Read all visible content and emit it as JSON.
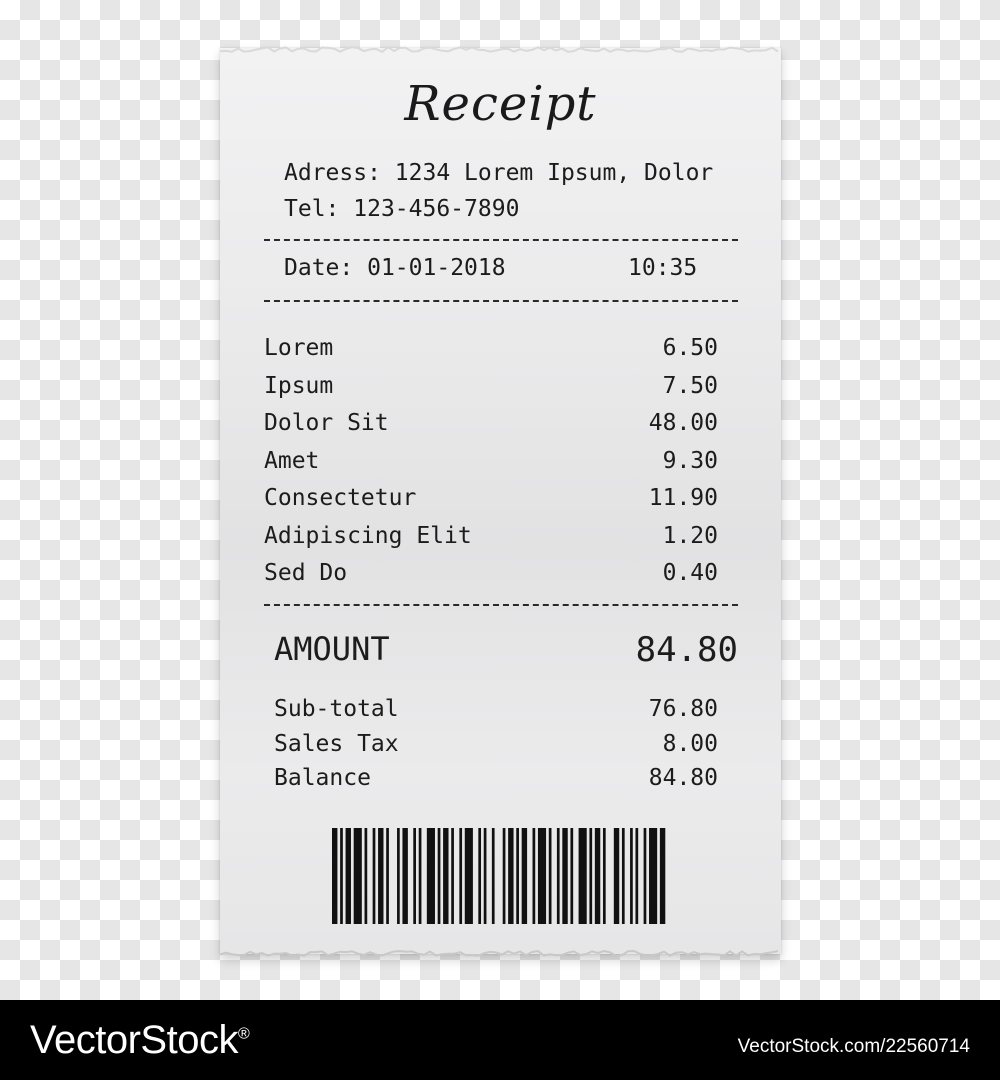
{
  "receipt": {
    "title": "Receipt",
    "address_label": "Adress:",
    "address_value": "1234 Lorem Ipsum, Dolor",
    "tel_label": "Tel:",
    "tel_value": "123-456-7890",
    "date_label": "Date:",
    "date_value": "01-01-2018",
    "time_value": "10:35",
    "items": [
      {
        "name": "Lorem",
        "price": "6.50"
      },
      {
        "name": "Ipsum",
        "price": "7.50"
      },
      {
        "name": "Dolor Sit",
        "price": "48.00"
      },
      {
        "name": "Amet",
        "price": "9.30"
      },
      {
        "name": "Consectetur",
        "price": "11.90"
      },
      {
        "name": "Adipiscing Elit",
        "price": "1.20"
      },
      {
        "name": "Sed Do",
        "price": "0.40"
      }
    ],
    "amount_label": "AMOUNT",
    "amount_value": "84.80",
    "summary": [
      {
        "name": "Sub-total",
        "price": "76.80"
      },
      {
        "name": "Sales Tax",
        "price": "8.00"
      },
      {
        "name": "Balance",
        "price": "84.80"
      }
    ],
    "barcode_pattern": [
      2,
      1,
      1,
      1,
      2,
      1,
      3,
      1,
      1,
      2,
      1,
      1,
      2,
      1,
      1,
      3,
      1,
      1,
      2,
      2,
      1,
      1,
      1,
      2,
      3,
      1,
      1,
      1,
      2,
      1,
      1,
      2,
      1,
      1,
      3,
      2,
      1,
      1,
      1,
      2,
      1,
      3,
      1,
      1,
      2,
      1,
      1,
      1,
      2,
      2,
      1,
      1,
      3,
      1,
      1,
      2,
      1,
      1,
      2,
      1,
      1,
      2,
      3,
      1,
      1,
      1,
      2,
      1,
      1,
      3,
      2,
      1,
      1,
      2,
      1,
      1,
      1,
      2,
      1,
      1,
      3,
      1,
      2,
      1
    ]
  },
  "watermark": {
    "brand": "VectorStock",
    "registered": "®",
    "image_id": "VectorStock.com/22560714"
  }
}
